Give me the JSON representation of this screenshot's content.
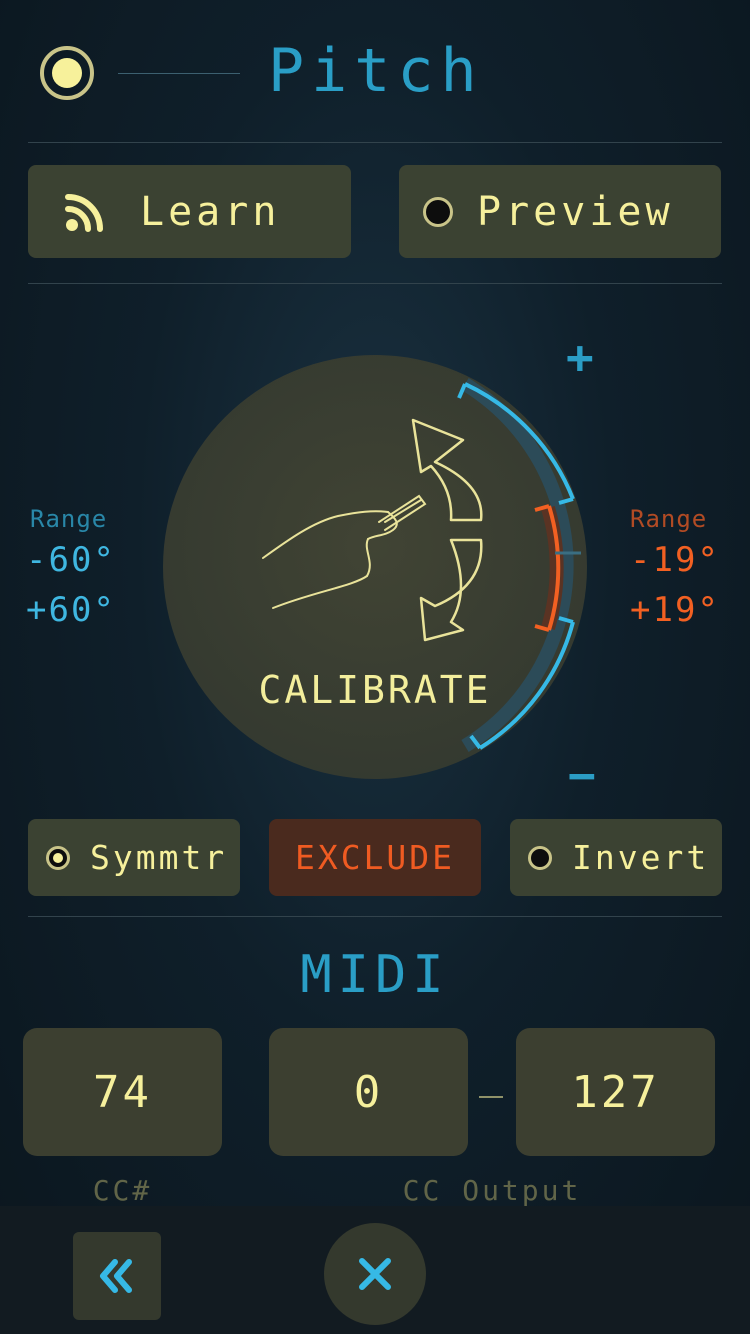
{
  "header": {
    "title": "Pitch",
    "power_on": true
  },
  "buttons": {
    "learn_label": "Learn",
    "preview_label": "Preview"
  },
  "dial": {
    "calibrate_label": "CALIBRATE",
    "plus_label": "+",
    "minus_label": "−",
    "left_range": {
      "label": "Range",
      "min": "-60°",
      "max": "+60°"
    },
    "right_range": {
      "label": "Range",
      "min": "-19°",
      "max": "+19°"
    }
  },
  "options": {
    "symmetric_label": "Symmtr",
    "exclude_label": "EXCLUDE",
    "invert_label": "Invert"
  },
  "midi": {
    "title": "MIDI",
    "cc_number": "74",
    "cc_min": "0",
    "cc_max": "127",
    "cc_number_label": "CC#",
    "cc_output_label": "CC Output"
  },
  "nav": {
    "back_icon": "double-chevron-left-icon",
    "close_icon": "close-icon"
  },
  "colors": {
    "accent_blue": "#2a9ec6",
    "accent_orange": "#f26022",
    "text_yellow": "#f6f09c"
  }
}
